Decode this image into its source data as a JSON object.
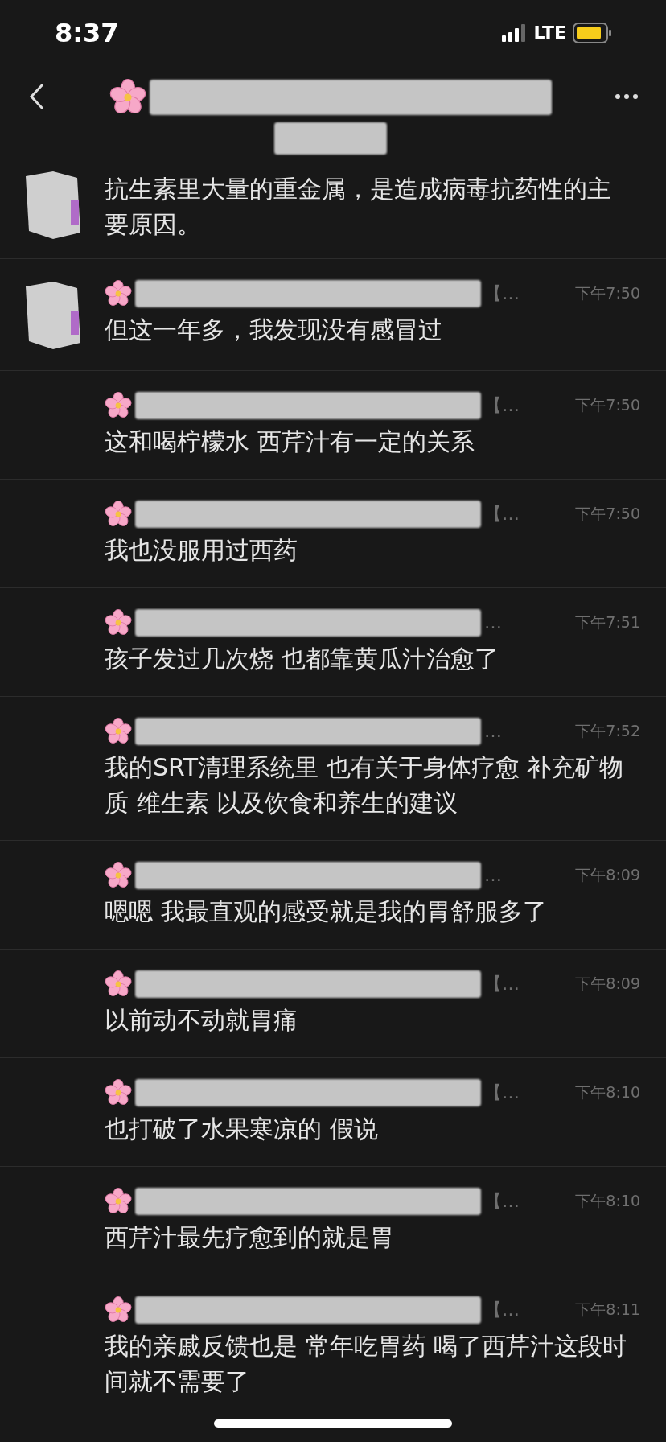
{
  "status_bar": {
    "time": "8:37",
    "network": "LTE"
  },
  "messages": [
    {
      "kind": "cut",
      "has_avatar": true,
      "text": "抗生素里大量的重金属，是造成病毒抗药性的主要原因。"
    },
    {
      "kind": "full",
      "has_avatar": true,
      "name_suffix": "【…",
      "time": "下午7:50",
      "text": "但这一年多，我发现没有感冒过"
    },
    {
      "kind": "full",
      "has_avatar": false,
      "name_suffix": "【…",
      "time": "下午7:50",
      "text": "这和喝柠檬水 西芹汁有一定的关系"
    },
    {
      "kind": "full",
      "has_avatar": false,
      "name_suffix": "【…",
      "time": "下午7:50",
      "text": "我也没服用过西药"
    },
    {
      "kind": "full",
      "has_avatar": false,
      "name_suffix": "…",
      "time": "下午7:51",
      "text": "孩子发过几次烧 也都靠黄瓜汁治愈了"
    },
    {
      "kind": "full",
      "has_avatar": false,
      "name_suffix": "…",
      "time": "下午7:52",
      "text": "我的SRT清理系统里 也有关于身体疗愈 补充矿物质 维生素 以及饮食和养生的建议"
    },
    {
      "kind": "full",
      "has_avatar": false,
      "name_suffix": "…",
      "time": "下午8:09",
      "text": "嗯嗯 我最直观的感受就是我的胃舒服多了"
    },
    {
      "kind": "full",
      "has_avatar": false,
      "name_suffix": "【…",
      "time": "下午8:09",
      "text": "以前动不动就胃痛"
    },
    {
      "kind": "full",
      "has_avatar": false,
      "name_suffix": "【…",
      "time": "下午8:10",
      "text": "也打破了水果寒凉的 假说"
    },
    {
      "kind": "full",
      "has_avatar": false,
      "name_suffix": "【…",
      "time": "下午8:10",
      "text": "西芹汁最先疗愈到的就是胃"
    },
    {
      "kind": "full",
      "has_avatar": false,
      "name_suffix": "【…",
      "time": "下午8:11",
      "text": "我的亲戚反馈也是 常年吃胃药 喝了西芹汁这段时间就不需要了"
    }
  ]
}
